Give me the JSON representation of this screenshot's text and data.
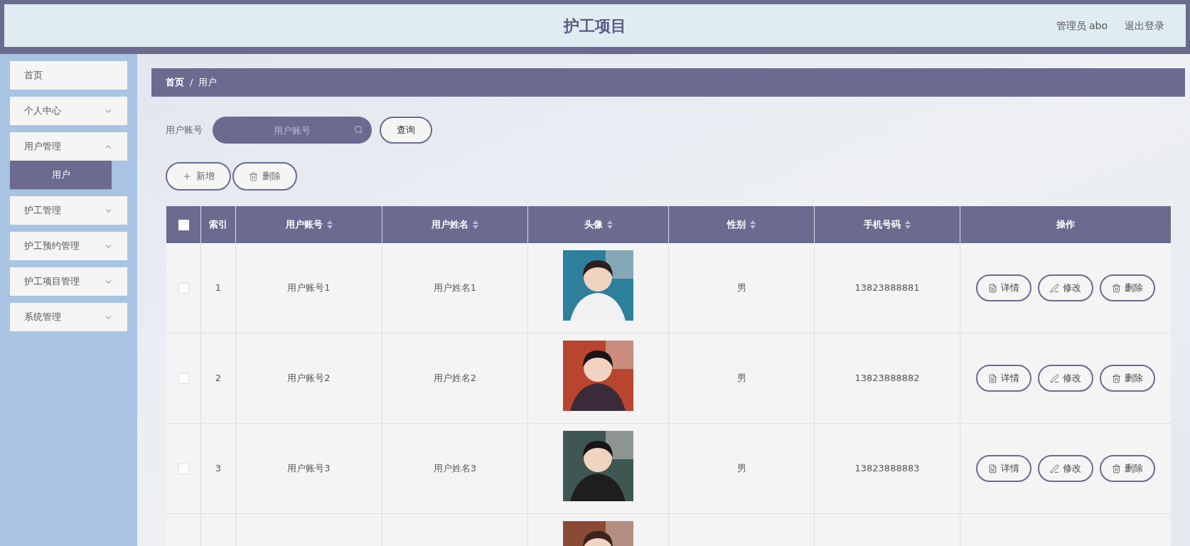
{
  "header": {
    "title": "护工项目",
    "user": "管理员 abo",
    "logout": "退出登录"
  },
  "sidebar": {
    "items": [
      {
        "label": "首页",
        "kind": "link"
      },
      {
        "label": "个人中心",
        "kind": "submenu",
        "expanded": false
      },
      {
        "label": "用户管理",
        "kind": "submenu",
        "expanded": true,
        "children": [
          {
            "label": "用户",
            "selected": true
          }
        ]
      },
      {
        "label": "护工管理",
        "kind": "submenu",
        "expanded": false
      },
      {
        "label": "护工预约管理",
        "kind": "submenu",
        "expanded": false
      },
      {
        "label": "护工项目管理",
        "kind": "submenu",
        "expanded": false
      },
      {
        "label": "系统管理",
        "kind": "submenu",
        "expanded": false
      }
    ]
  },
  "breadcrumb": [
    "首页",
    "/",
    "用户"
  ],
  "search": {
    "label": "用户账号",
    "placeholder": "用户账号",
    "button": "查询"
  },
  "actions": [
    {
      "label": "新增",
      "kind": "add"
    },
    {
      "label": "删除",
      "kind": "delete"
    }
  ],
  "table": {
    "select_all": {
      "checked": false
    },
    "columns": [
      {
        "label": "索引",
        "sortable": false
      },
      {
        "label": "用户账号",
        "sortable": true
      },
      {
        "label": "用户姓名",
        "sortable": true
      },
      {
        "label": "头像",
        "sortable": true
      },
      {
        "label": "性别",
        "sortable": true
      },
      {
        "label": "手机号码",
        "sortable": true
      },
      {
        "label": "操作",
        "sortable": false
      }
    ],
    "rows": [
      {
        "checked": false,
        "index": "1",
        "account": "用户账号1",
        "name": "用户姓名1",
        "avatar": {
          "kind": "picture"
        },
        "gender": "男",
        "phone": "13823888881",
        "buttons": [
          {
            "label": "详情",
            "kind": "detail"
          },
          {
            "label": "修改",
            "kind": "edit"
          },
          {
            "label": "删除",
            "kind": "delete"
          }
        ]
      },
      {
        "checked": false,
        "index": "2",
        "account": "用户账号2",
        "name": "用户姓名2",
        "avatar": {
          "kind": "picture"
        },
        "gender": "男",
        "phone": "13823888882",
        "buttons": [
          {
            "label": "详情",
            "kind": "detail"
          },
          {
            "label": "修改",
            "kind": "edit"
          },
          {
            "label": "删除",
            "kind": "delete"
          }
        ]
      },
      {
        "checked": false,
        "index": "3",
        "account": "用户账号3",
        "name": "用户姓名3",
        "avatar": {
          "kind": "picture"
        },
        "gender": "男",
        "phone": "13823888883",
        "buttons": [
          {
            "label": "详情",
            "kind": "detail"
          },
          {
            "label": "修改",
            "kind": "edit"
          },
          {
            "label": "删除",
            "kind": "delete"
          }
        ]
      },
      {
        "avatar": {
          "kind": "picture"
        }
      }
    ]
  }
}
